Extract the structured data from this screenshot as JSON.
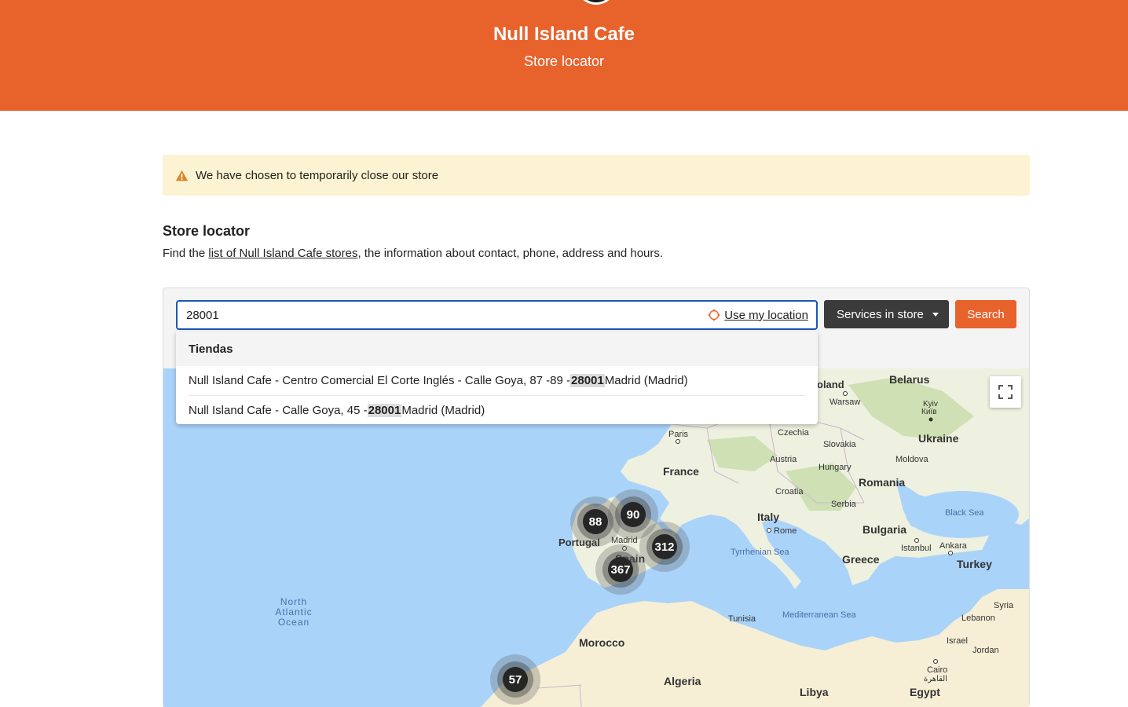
{
  "header": {
    "title": "Null Island Cafe",
    "subtitle": "Store locator"
  },
  "alert": {
    "text": "We have chosen to temporarily close our store",
    "icon": "warning-icon"
  },
  "intro": {
    "title": "Store locator",
    "text_before": "Find the ",
    "link": "list of Null Island Cafe stores",
    "text_after": ", the information about contact, phone, address and hours."
  },
  "search": {
    "value": "28001",
    "use_location_label": "Use my location",
    "services_label": "Services in store",
    "search_label": "Search"
  },
  "suggestions": {
    "header": "Tiendas",
    "items": [
      {
        "before": "Null Island Cafe - Centro Comercial El Corte Inglés - Calle Goya, 87 -89 - ",
        "match": "28001",
        "after": " Madrid (Madrid)"
      },
      {
        "before": "Null Island Cafe - Calle Goya, 45 - ",
        "match": "28001",
        "after": " Madrid (Madrid)"
      }
    ]
  },
  "map": {
    "colors": {
      "sea": "#aad3f9",
      "land": "#eef0e0",
      "forest": "#cfe0b4",
      "desert": "#f6efd6",
      "cluster": "#262626"
    },
    "labels": {
      "poland": "oland",
      "warsaw": "Warsaw",
      "belarus": "Belarus",
      "kyiv": "Kyiv",
      "kyiv_local": "Київ",
      "ukraine": "Ukraine",
      "moldova": "Moldova",
      "paris": "Paris",
      "czechia": "Czechia",
      "slovakia": "Slovakia",
      "austria": "Austria",
      "hungary": "Hungary",
      "france": "France",
      "romania": "Romania",
      "croatia": "Croatia",
      "serbia": "Serbia",
      "black_sea": "Black Sea",
      "italy": "Italy",
      "bulgaria": "Bulgaria",
      "rome": "Rome",
      "istanbul": "Istanbul",
      "ankara": "Ankara",
      "portugal": "Portugal",
      "madrid": "Madrid",
      "spain": "Spain",
      "tyrrhenian": "Tyrrhenian Sea",
      "greece": "Greece",
      "turkey": "Turkey",
      "atlantic_1": "North",
      "atlantic_2": "Atlantic",
      "atlantic_3": "Ocean",
      "tunisia": "Tunisia",
      "mediterranean": "Mediterranean Sea",
      "syria": "Syria",
      "lebanon": "Lebanon",
      "morocco": "Morocco",
      "israel": "Israel",
      "jordan": "Jordan",
      "cairo": "Cairo",
      "cairo_local": "القاهرة",
      "algeria": "Algeria",
      "libya": "Libya",
      "egypt": "Egypt"
    },
    "clusters": [
      {
        "id": "a",
        "count": "88"
      },
      {
        "id": "b",
        "count": "90"
      },
      {
        "id": "c",
        "count": "312"
      },
      {
        "id": "d",
        "count": "367"
      },
      {
        "id": "e",
        "count": "57"
      }
    ]
  }
}
